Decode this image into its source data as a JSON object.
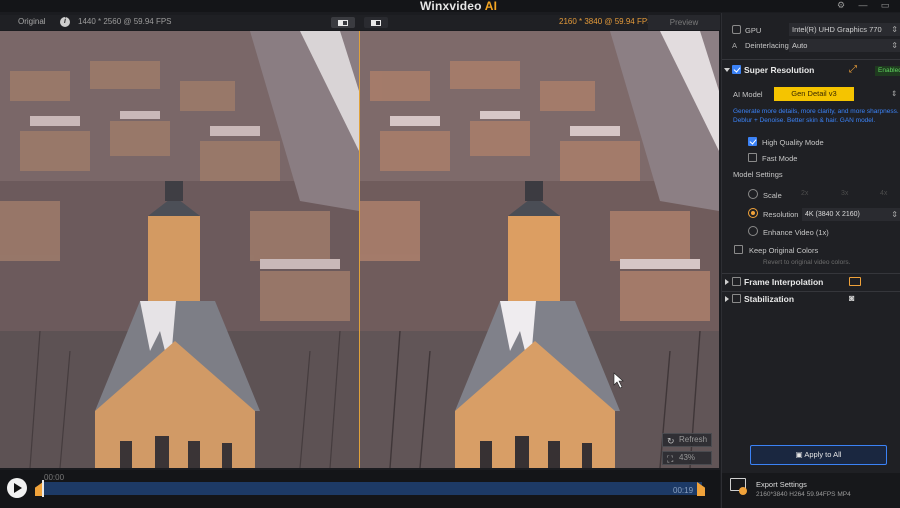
{
  "app": {
    "title_main": "Winxvideo",
    "title_ai": "AI"
  },
  "window_controls": {
    "settings_icon": "gear-icon",
    "minimize_icon": "minimize-icon",
    "maximize_icon": "maximize-icon"
  },
  "header": {
    "original_tab": "Original",
    "info_icon": "i",
    "left_resolution": "1440 * 2560 @ 59.94 FPS",
    "right_resolution": "2160 * 3840 @ 59.94 FPS",
    "preview_tab": "Preview"
  },
  "preview_overlay": {
    "refresh_label": "Refresh",
    "zoom_label": "43%"
  },
  "timeline": {
    "current_time": "00:00",
    "end_time": "00:19",
    "progress": 0
  },
  "panel": {
    "gpu_label": "GPU",
    "gpu_value": "Intel(R) UHD Graphics 770",
    "deinterlacing_label": "Deinterlacing",
    "deinterlacing_value": "Auto",
    "super_resolution": {
      "title": "Super Resolution",
      "status": "Enabled",
      "ai_model_label": "AI Model",
      "ai_model_value": "Gen Detail v3",
      "description": "Generate more details, more clarity, and more sharpness. Deblur + Denoise. Better skin & hair. GAN model.",
      "high_quality_label": "High Quality Mode",
      "fast_mode_label": "Fast Mode",
      "model_settings_label": "Model Settings",
      "scale_label": "Scale",
      "scale_options": [
        "2x",
        "3x",
        "4x"
      ],
      "resolution_label": "Resolution",
      "resolution_value": "4K (3840 X 2160)",
      "enhance_video_label": "Enhance Video (1x)",
      "keep_colors_label": "Keep Original Colors",
      "keep_colors_hint": "Revert to original video colors."
    },
    "frame_interpolation_title": "Frame Interpolation",
    "stabilization_title": "Stabilization",
    "apply_button": "Apply to All",
    "export": {
      "title": "Export Settings",
      "info": "2160*3840   H264  59.94FPS   MP4"
    }
  },
  "colors": {
    "accent_orange": "#f0a23a",
    "accent_blue": "#3b82f6",
    "ai_model_yellow": "#f5c400",
    "enabled_green": "#5fd35f"
  }
}
